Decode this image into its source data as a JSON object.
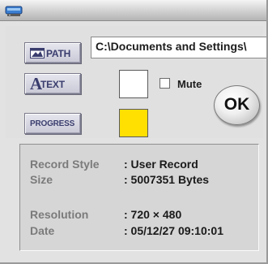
{
  "window": {
    "title_icon": "disk-drive-icon"
  },
  "buttons": {
    "path_label": "PATH",
    "path_icon": "folder-picture-icon",
    "text_glyph": "A",
    "text_label": "TEXT",
    "progress_label": "PROGRESS"
  },
  "path_field": {
    "value": "C:\\Documents and Settings\\"
  },
  "swatches": {
    "text_color": "#ffffff",
    "progress_color": "#ffe000"
  },
  "mute": {
    "label": "Mute",
    "checked": false
  },
  "ok": {
    "label": "OK"
  },
  "info": {
    "record_style_key": "Record Style",
    "record_style_value": ": User Record",
    "size_key": "Size",
    "size_value": ": 5007351 Bytes",
    "resolution_key": "Resolution",
    "resolution_value": ": 720 × 480",
    "date_key": "Date",
    "date_value": ": 05/12/27  09:10:01"
  }
}
